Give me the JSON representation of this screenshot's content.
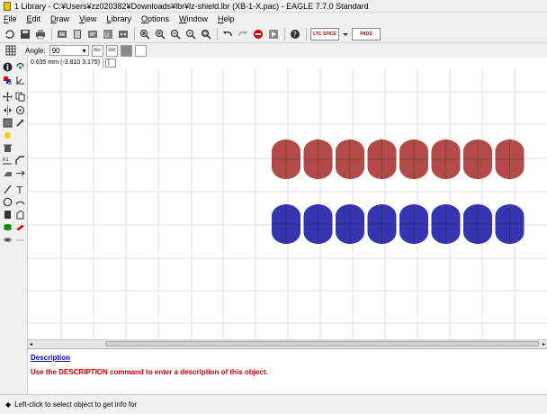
{
  "window": {
    "title": "1 Library - C:¥Users¥zz020382¥Downloads¥lbr¥lz-shield.lbr (XB-1-X.pac) - EAGLE 7.7.0 Standard"
  },
  "menu": [
    {
      "accel": "F",
      "rest": "ile"
    },
    {
      "accel": "E",
      "rest": "dit"
    },
    {
      "accel": "D",
      "rest": "raw"
    },
    {
      "accel": "V",
      "rest": "iew"
    },
    {
      "accel": "L",
      "rest": "ibrary"
    },
    {
      "accel": "O",
      "rest": "ptions"
    },
    {
      "accel": "W",
      "rest": "indow"
    },
    {
      "accel": "H",
      "rest": "elp"
    }
  ],
  "toolbar": {
    "ltspice_label": "LTC SPICE",
    "pads_label": "PADS"
  },
  "params": {
    "angle_label": "Angle:",
    "angle_value": "90"
  },
  "coord": {
    "readout": "0.635 mm (-3.810 3.175)",
    "command": "|"
  },
  "pads": {
    "top_color": "#b14a48",
    "bottom_color": "#3535b0",
    "count_per_row": 8
  },
  "description": {
    "title": "Description",
    "text": "Use the DESCRIPTION command to enter a description of this object."
  },
  "status": {
    "text": "Left-click to select object to get info for"
  }
}
